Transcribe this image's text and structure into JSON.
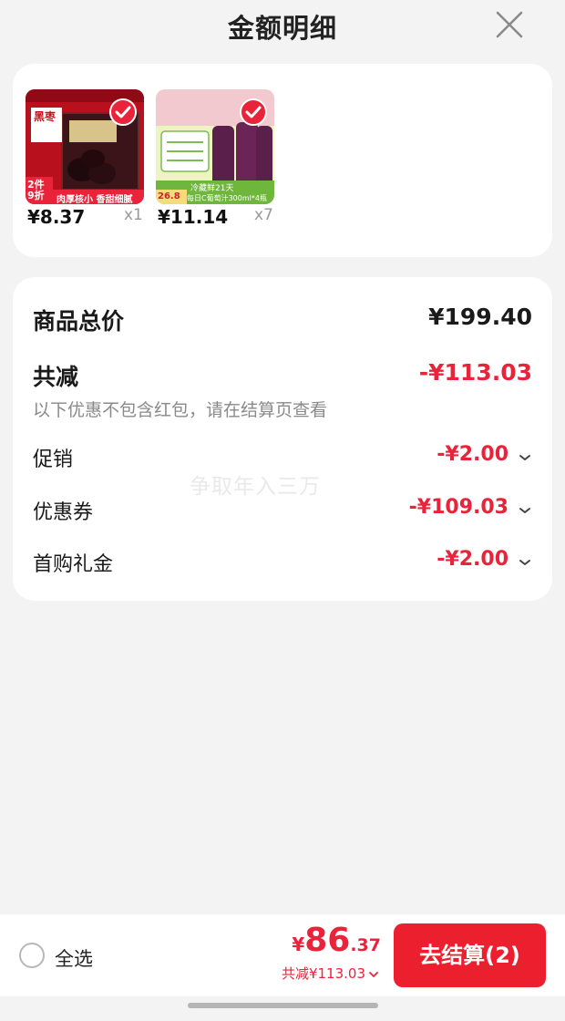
{
  "header": {
    "title": "金额明细"
  },
  "products": [
    {
      "price": "¥8.37",
      "qty": "x1",
      "image_text": {
        "tag": "2件9折",
        "title": "黑枣",
        "banner": "肉厚核小 香甜细腻"
      }
    },
    {
      "price": "¥11.14",
      "qty": "x7",
      "image_text": {
        "top": "冷藏鲜21天",
        "banner": "每日C葡萄汁300ml*4瓶",
        "price_tag": "26.8"
      }
    }
  ],
  "summary": {
    "total_label": "商品总价",
    "total_value": "¥199.40",
    "reduce_label": "共减",
    "reduce_value": "-¥113.03",
    "note": "以下优惠不包含红包，请在结算页查看",
    "items": [
      {
        "label": "促销",
        "value": "-¥2.00"
      },
      {
        "label": "优惠券",
        "value": "-¥109.03"
      },
      {
        "label": "首购礼金",
        "value": "-¥2.00"
      }
    ]
  },
  "watermark": "争取年入三万",
  "bottom_bar": {
    "select_all": "全选",
    "currency": "¥",
    "total_int": "86",
    "total_dec": ".37",
    "reduce_text": "共减¥113.03",
    "checkout": "去结算(2)"
  },
  "colors": {
    "accent": "#e8233a",
    "button": "#ec1f2f",
    "background": "#f3f3f3"
  }
}
